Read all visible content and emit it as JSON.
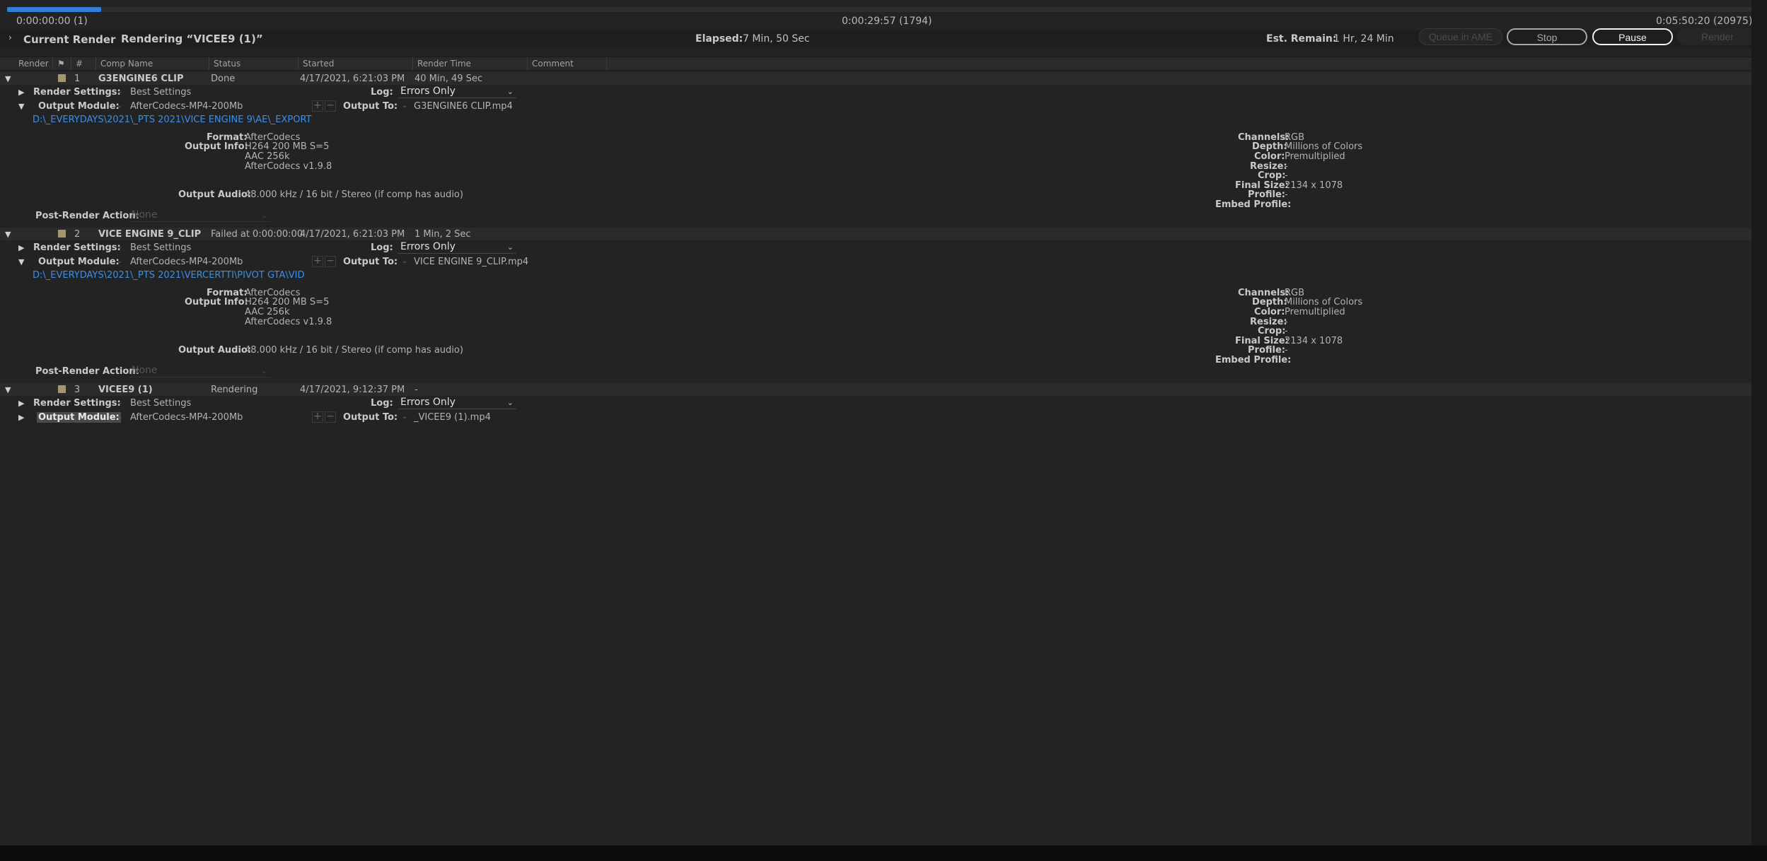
{
  "progress": {
    "fraction": 0.054,
    "start_time": "0:00:00:00 (1)",
    "current_time": "0:00:29:57 (1794)",
    "end_time": "0:05:50:20 (20975)"
  },
  "status": {
    "current_render_label": "Current Render",
    "rendering_label": "Rendering “VICEE9 (1)”",
    "elapsed_label": "Elapsed:",
    "elapsed_value": "7 Min, 50 Sec",
    "remain_label": "Est. Remain:",
    "remain_value": "1 Hr, 24 Min"
  },
  "buttons": {
    "queue_ame": "Queue in AME",
    "stop": "Stop",
    "pause": "Pause",
    "render": "Render"
  },
  "columns": [
    "Render",
    "#",
    "Comp Name",
    "Status",
    "Started",
    "Render Time",
    "Comment"
  ],
  "labels": {
    "render_settings": "Render Settings:",
    "log": "Log:",
    "output_module": "Output Module:",
    "output_to": "Output To:",
    "format": "Format:",
    "output_info": "Output Info:",
    "output_audio": "Output Audio:",
    "channels": "Channels:",
    "depth": "Depth:",
    "color": "Color:",
    "resize": "Resize:",
    "crop": "Crop:",
    "final_size": "Final Size:",
    "profile": "Profile:",
    "embed_profile": "Embed Profile:",
    "post_render": "Post-Render Action:"
  },
  "items": [
    {
      "num": "1",
      "comp": "G3ENGINE6 CLIP",
      "status": "Done",
      "started": "4/17/2021, 6:21:03 PM",
      "render_time": "40 Min, 49 Sec",
      "render_settings": "Best Settings",
      "log": "Errors Only",
      "output_module": "AfterCodecs-MP4-200Mb",
      "output_to": "G3ENGINE6 CLIP.mp4",
      "path": "D:\\_EVERYDAYS\\2021\\_PTS 2021\\VICE ENGINE 9\\AE\\_EXPORT",
      "format": "AfterCodecs",
      "info1": "H264 200 MB S=5",
      "info2": "AAC 256k",
      "info3": "AfterCodecs v1.9.8",
      "audio": "48.000 kHz / 16 bit / Stereo (if comp has audio)",
      "channels": "RGB",
      "depth": "Millions of Colors",
      "color": "Premultiplied",
      "resize": "-",
      "crop": "-",
      "final_size": "2134 x 1078",
      "profile": "-",
      "embed_profile": "",
      "post_render": "None"
    },
    {
      "num": "2",
      "comp": "VICE ENGINE 9_CLIP",
      "status": "Failed at 0:00:00:00",
      "started": "4/17/2021, 6:21:03 PM",
      "render_time": "1 Min, 2 Sec",
      "render_settings": "Best Settings",
      "log": "Errors Only",
      "output_module": "AfterCodecs-MP4-200Mb",
      "output_to": "VICE ENGINE 9_CLIP.mp4",
      "path": "D:\\_EVERYDAYS\\2021\\_PTS 2021\\VERCERTTI\\PIVOT GTA\\VID",
      "format": "AfterCodecs",
      "info1": "H264 200 MB S=5",
      "info2": "AAC 256k",
      "info3": "AfterCodecs v1.9.8",
      "audio": "48.000 kHz / 16 bit / Stereo (if comp has audio)",
      "channels": "RGB",
      "depth": "Millions of Colors",
      "color": "Premultiplied",
      "resize": "-",
      "crop": "-",
      "final_size": "2134 x 1078",
      "profile": "-",
      "embed_profile": "",
      "post_render": "None"
    },
    {
      "num": "3",
      "comp": "VICEE9 (1)",
      "status": "Rendering",
      "started": "4/17/2021, 9:12:37 PM",
      "render_time": "-",
      "render_settings": "Best Settings",
      "log": "Errors Only",
      "output_module": "AfterCodecs-MP4-200Mb",
      "output_to": "_VICEE9 (1).mp4"
    }
  ]
}
